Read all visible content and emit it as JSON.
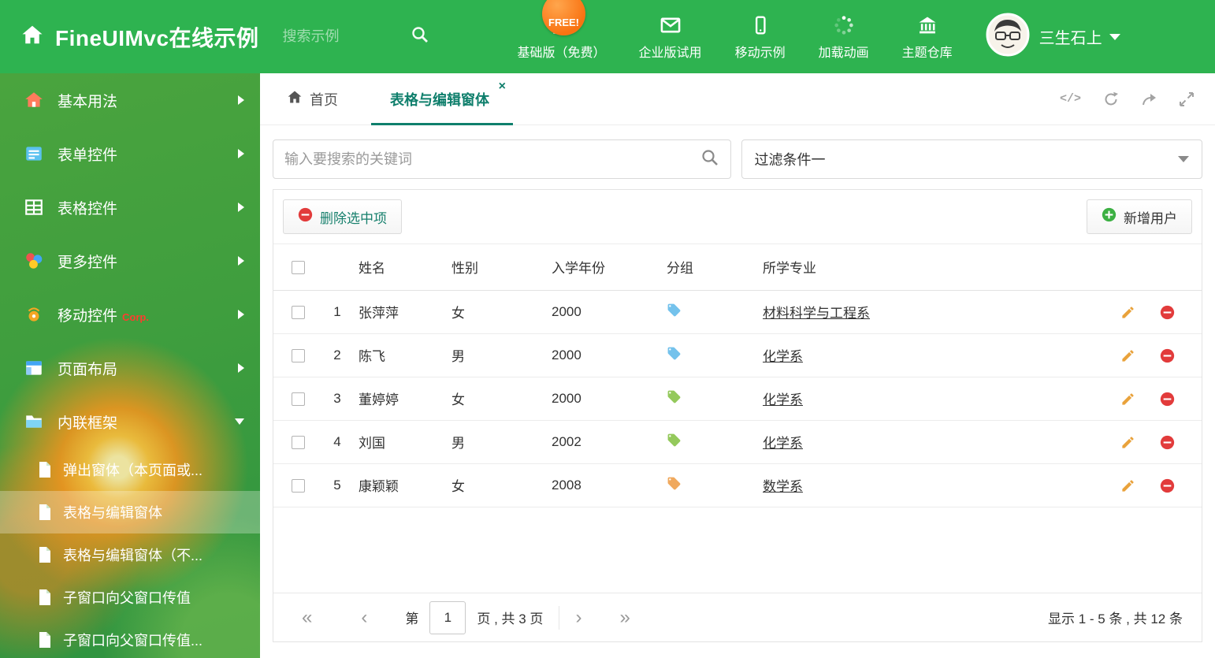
{
  "header": {
    "app_title": "FineUIMvc在线示例",
    "search_placeholder": "搜索示例",
    "free_badge": "FREE!",
    "nav_items": [
      {
        "label": "基础版（免费）",
        "icon": "download-icon"
      },
      {
        "label": "企业版试用",
        "icon": "mail-icon"
      },
      {
        "label": "移动示例",
        "icon": "mobile-icon"
      },
      {
        "label": "加载动画",
        "icon": "spinner-icon"
      },
      {
        "label": "主题仓库",
        "icon": "bank-icon"
      }
    ],
    "user_name": "三生石上"
  },
  "sidebar": {
    "items": [
      {
        "label": "基本用法"
      },
      {
        "label": "表单控件"
      },
      {
        "label": "表格控件"
      },
      {
        "label": "更多控件"
      },
      {
        "label": "移动控件",
        "badge": "Corp."
      },
      {
        "label": "页面布局"
      },
      {
        "label": "内联框架"
      }
    ],
    "subitems": [
      {
        "label": "弹出窗体（本页面或..."
      },
      {
        "label": "表格与编辑窗体",
        "active": true
      },
      {
        "label": "表格与编辑窗体（不..."
      },
      {
        "label": "子窗口向父窗口传值"
      },
      {
        "label": "子窗口向父窗口传值..."
      }
    ]
  },
  "tabs": {
    "home_label": "首页",
    "active_label": "表格与编辑窗体",
    "close_glyph": "×",
    "code_tool_glyph": "</>"
  },
  "filters": {
    "search_placeholder": "输入要搜索的关键词",
    "filter_value": "过滤条件一"
  },
  "toolbar": {
    "delete_label": "删除选中项",
    "add_label": "新增用户"
  },
  "table": {
    "columns": {
      "name": "姓名",
      "gender": "性别",
      "year": "入学年份",
      "group": "分组",
      "major": "所学专业"
    },
    "rows": [
      {
        "num": "1",
        "name": "张萍萍",
        "gender": "女",
        "year": "2000",
        "tag_color": "#74c2ec",
        "major": "材料科学与工程系"
      },
      {
        "num": "2",
        "name": "陈飞",
        "gender": "男",
        "year": "2000",
        "tag_color": "#74c2ec",
        "major": "化学系"
      },
      {
        "num": "3",
        "name": "董婷婷",
        "gender": "女",
        "year": "2000",
        "tag_color": "#94c95c",
        "major": "化学系"
      },
      {
        "num": "4",
        "name": "刘国",
        "gender": "男",
        "year": "2002",
        "tag_color": "#94c95c",
        "major": "化学系"
      },
      {
        "num": "5",
        "name": "康颖颖",
        "gender": "女",
        "year": "2008",
        "tag_color": "#f0a95e",
        "major": "数学系"
      }
    ]
  },
  "pagination": {
    "first_glyph": "«",
    "prev_glyph": "‹",
    "next_glyph": "›",
    "last_glyph": "»",
    "page_prefix": "第",
    "current_page": "1",
    "page_suffix": "页 , 共 3 页",
    "summary": "显示 1 - 5 条 , 共 12 条"
  },
  "colors": {
    "header_green": "#2eb350",
    "accent_teal": "#0f7f6c",
    "danger_red": "#e23b3b",
    "success_green": "#3cb043",
    "pencil_orange": "#e9a23b"
  }
}
